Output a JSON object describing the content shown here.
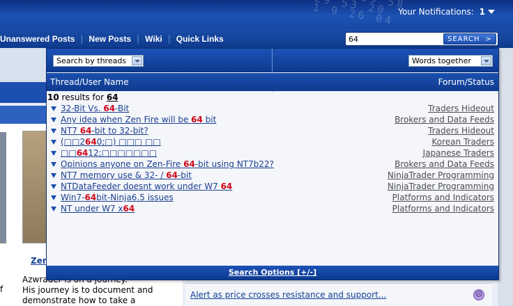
{
  "header": {
    "decorative_digits": "21 10 39 58\n 29 53 20\n 1 9 26 04",
    "notifications_label": "Your Notifications:",
    "notifications_count": "1"
  },
  "navbar": {
    "links": [
      "Unanswered Posts",
      "New Posts",
      "Wiki",
      "Quick Links"
    ],
    "search_value": "64",
    "search_button": "SEARCH",
    "search_arrow": ">"
  },
  "overlay": {
    "search_by": "Search by threads",
    "words_mode": "Words together",
    "col_left": "Thread/User Name",
    "col_right": "Forum/Status",
    "results_count": "10",
    "results_mid": " results for ",
    "results_term": "64",
    "results": [
      {
        "pre": "32-Bit Vs. ",
        "hl": "64",
        "post": "-Bit",
        "forum": "Traders Hideout"
      },
      {
        "pre": "Any idea when Zen Fire will be ",
        "hl": "64",
        "post": " bit",
        "forum": "Brokers and Data Feeds"
      },
      {
        "pre": "NT7 ",
        "hl": "64",
        "post": "-bit to 32-bit?",
        "forum": "Traders Hideout"
      },
      {
        "pre": "(□□2",
        "hl": "64",
        "post": "0;□) □□□ □□",
        "forum": "Korean Traders"
      },
      {
        "pre": "□□",
        "hl": "64",
        "post": "12;□□□□□□□",
        "forum": "Japanese Traders"
      },
      {
        "pre": "Opinions anyone on Zen-Fire ",
        "hl": "64",
        "post": "-bit using NT7b22?",
        "forum": "Brokers and Data Feeds"
      },
      {
        "pre": "NT7 memory use & 32- / ",
        "hl": "64",
        "post": "-bit",
        "forum": "NinjaTrader Programming"
      },
      {
        "pre": "NTDataFeeder doesnt work under W7 ",
        "hl": "64",
        "post": "",
        "forum": "NinjaTrader Programming"
      },
      {
        "pre": "Win7-",
        "hl": "64",
        "post": "bit-Ninja6.5 issues",
        "forum": "Platforms and Indicators"
      },
      {
        "pre": "NT under W7 x",
        "hl": "64",
        "post": "",
        "forum": "Platforms and Indicators"
      }
    ],
    "footer": "Search Options [+/-]"
  },
  "background": {
    "zen_label": "Zen",
    "blog_text": "Azwrader is on a journey. His journey is to document and demonstrate how to take a",
    "blog_line1": "Azwrader is on a journey.",
    "blog_line2": "His journey is to document and",
    "blog_line3": "demonstrate how to take a",
    "left_fragment": "f",
    "alert_text": "Alert as price crosses resistance and support...",
    "sad_icon_glyph": "☹"
  },
  "colors": {
    "header_blue": "#1d52b4",
    "highlight_red": "#d0061b",
    "link_blue": "#1b3f8f"
  }
}
